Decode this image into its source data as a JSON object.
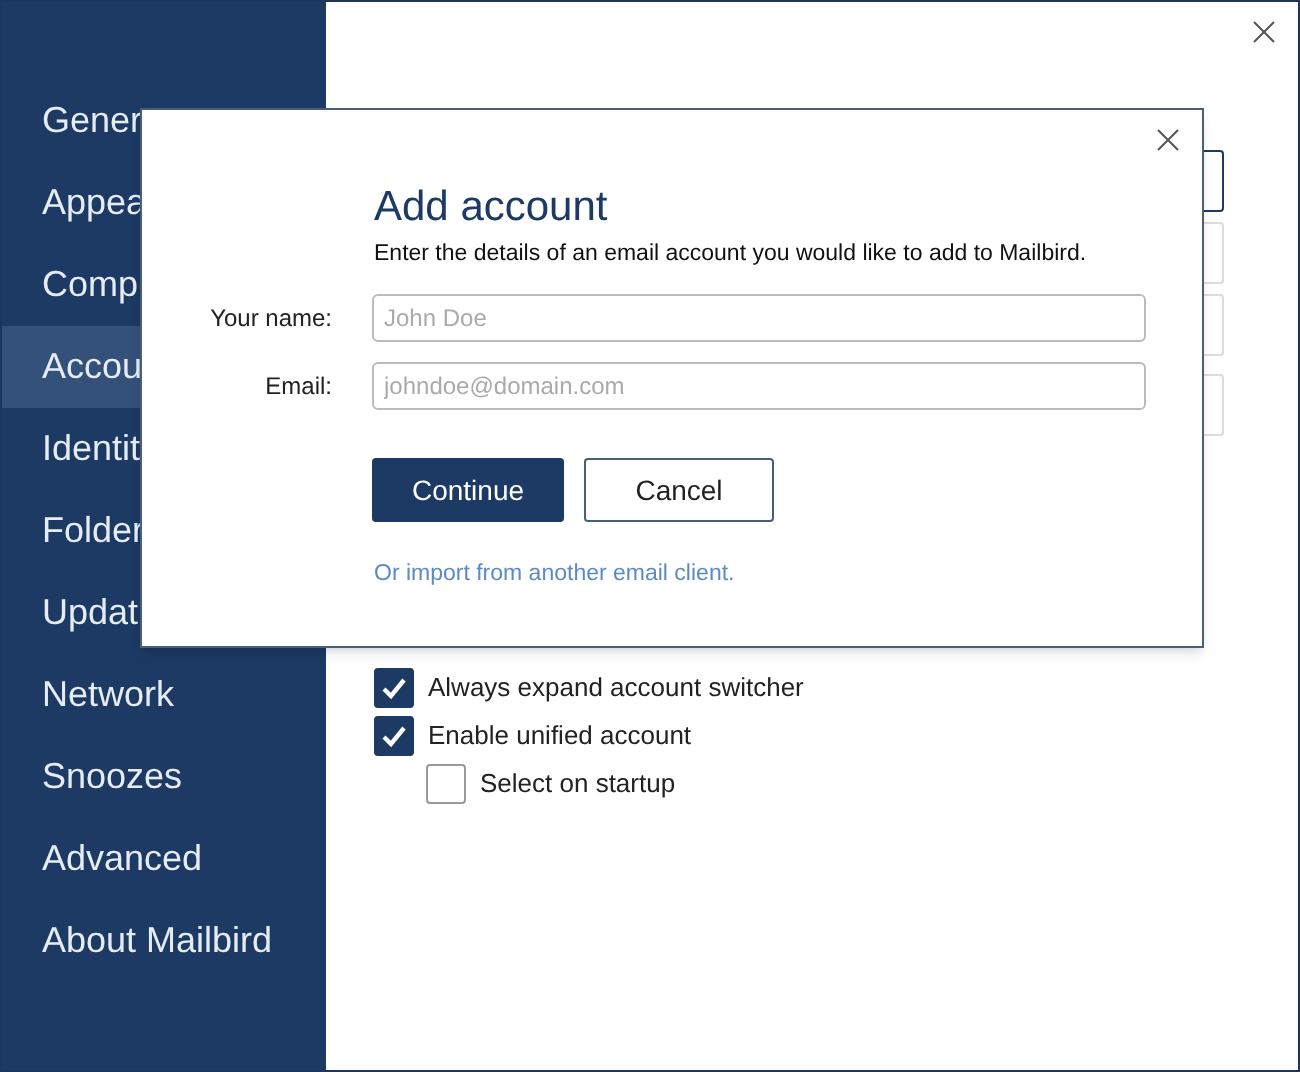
{
  "sidebar": {
    "items": [
      {
        "label": "Gener",
        "selected": false
      },
      {
        "label": "Appea",
        "selected": false
      },
      {
        "label": "Comp",
        "selected": false
      },
      {
        "label": "Accou",
        "selected": true
      },
      {
        "label": "Identit",
        "selected": false
      },
      {
        "label": "Folder",
        "selected": false
      },
      {
        "label": "Updat",
        "selected": false
      },
      {
        "label": "Network",
        "selected": false
      },
      {
        "label": "Snoozes",
        "selected": false
      },
      {
        "label": "Advanced",
        "selected": false
      },
      {
        "label": "About Mailbird",
        "selected": false
      }
    ]
  },
  "options": [
    {
      "label": "Always expand account switcher",
      "checked": true,
      "indented": false
    },
    {
      "label": "Enable unified account",
      "checked": true,
      "indented": false
    },
    {
      "label": "Select on startup",
      "checked": false,
      "indented": true
    }
  ],
  "dialog": {
    "title": "Add account",
    "subtitle": "Enter the details of an email account you would like to add to Mailbird.",
    "fields": [
      {
        "label": "Your name:",
        "placeholder": "John Doe"
      },
      {
        "label": "Email:",
        "placeholder": "johndoe@domain.com"
      }
    ],
    "primary_button": "Continue",
    "secondary_button": "Cancel",
    "link": "Or import from another email client."
  }
}
